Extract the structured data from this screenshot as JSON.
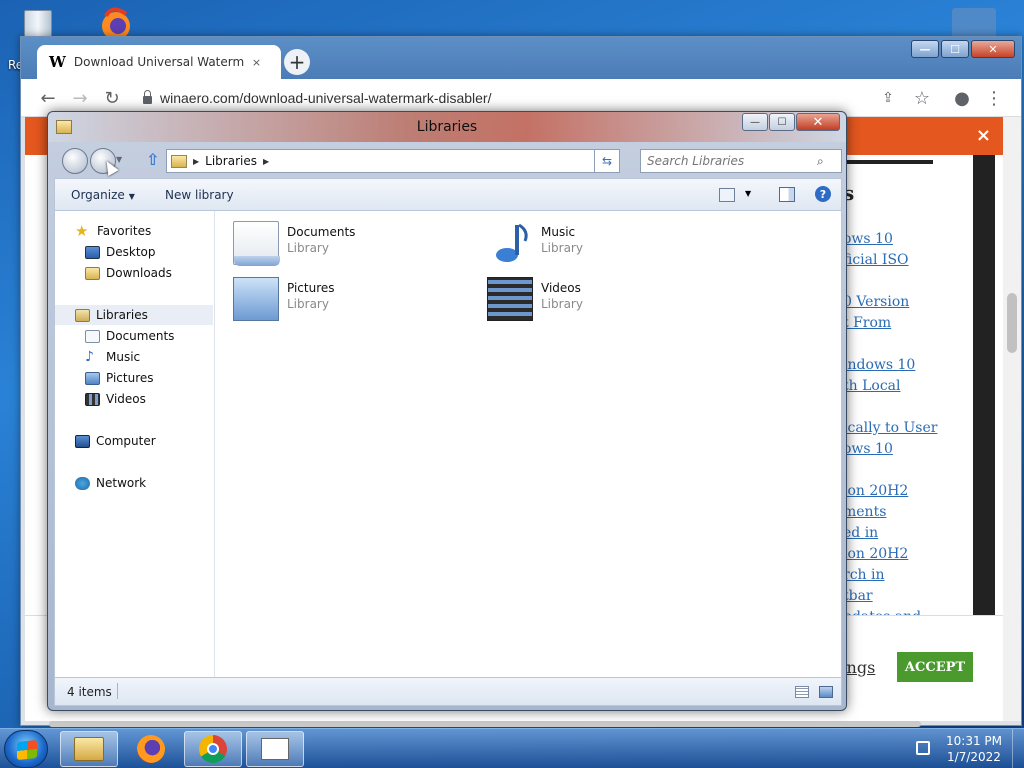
{
  "desktop": {
    "recycle_label": "Re"
  },
  "browser": {
    "tab": {
      "favicon": "W",
      "title": "Download Universal Watermark",
      "close": "×"
    },
    "new_tab": "+",
    "window_buttons": {
      "minimize": "—",
      "maximize": "☐",
      "close": "✕"
    },
    "nav": {
      "back": "←",
      "forward": "→",
      "reload": "↻"
    },
    "url": "winaero.com/download-universal-watermark-disabler/",
    "toolbar_icons": [
      "share-icon",
      "star-icon",
      "profile-icon",
      "menu-icon"
    ],
    "banner_close": "×",
    "aside": {
      "heading": "s",
      "links": [
        "ows 10",
        "ficial ISO",
        "0 Version",
        "t From",
        "indows 10",
        "th Local",
        "ically to User",
        "ows 10",
        "ion 20H2",
        "ments",
        "ed in",
        "ion 20H2",
        "rch in",
        "tbar",
        "pdates and"
      ]
    },
    "cookie": {
      "settings": "tings",
      "accept": "ACCEPT"
    }
  },
  "explorer": {
    "title": "Libraries",
    "window_buttons": {
      "minimize": "—",
      "maximize": "☐",
      "close": "✕"
    },
    "address": {
      "segment": "Libraries"
    },
    "search": {
      "placeholder": "Search Libraries"
    },
    "commands": {
      "organize": "Organize",
      "new_library": "New library"
    },
    "nav_pane": {
      "favorites": "Favorites",
      "favorites_items": [
        "Desktop",
        "Downloads"
      ],
      "libraries": "Libraries",
      "libraries_items": [
        "Documents",
        "Music",
        "Pictures",
        "Videos"
      ],
      "computer": "Computer",
      "network": "Network"
    },
    "items": [
      {
        "name": "Documents",
        "type": "Library"
      },
      {
        "name": "Music",
        "type": "Library"
      },
      {
        "name": "Pictures",
        "type": "Library"
      },
      {
        "name": "Videos",
        "type": "Library"
      }
    ],
    "status": "4 items"
  },
  "taskbar": {
    "clock": {
      "time": "10:31 PM",
      "date": "1/7/2022"
    }
  },
  "colors": {
    "banner": "#e4571f",
    "accept_button": "#4a9a2e",
    "link": "#2a6bb4"
  }
}
